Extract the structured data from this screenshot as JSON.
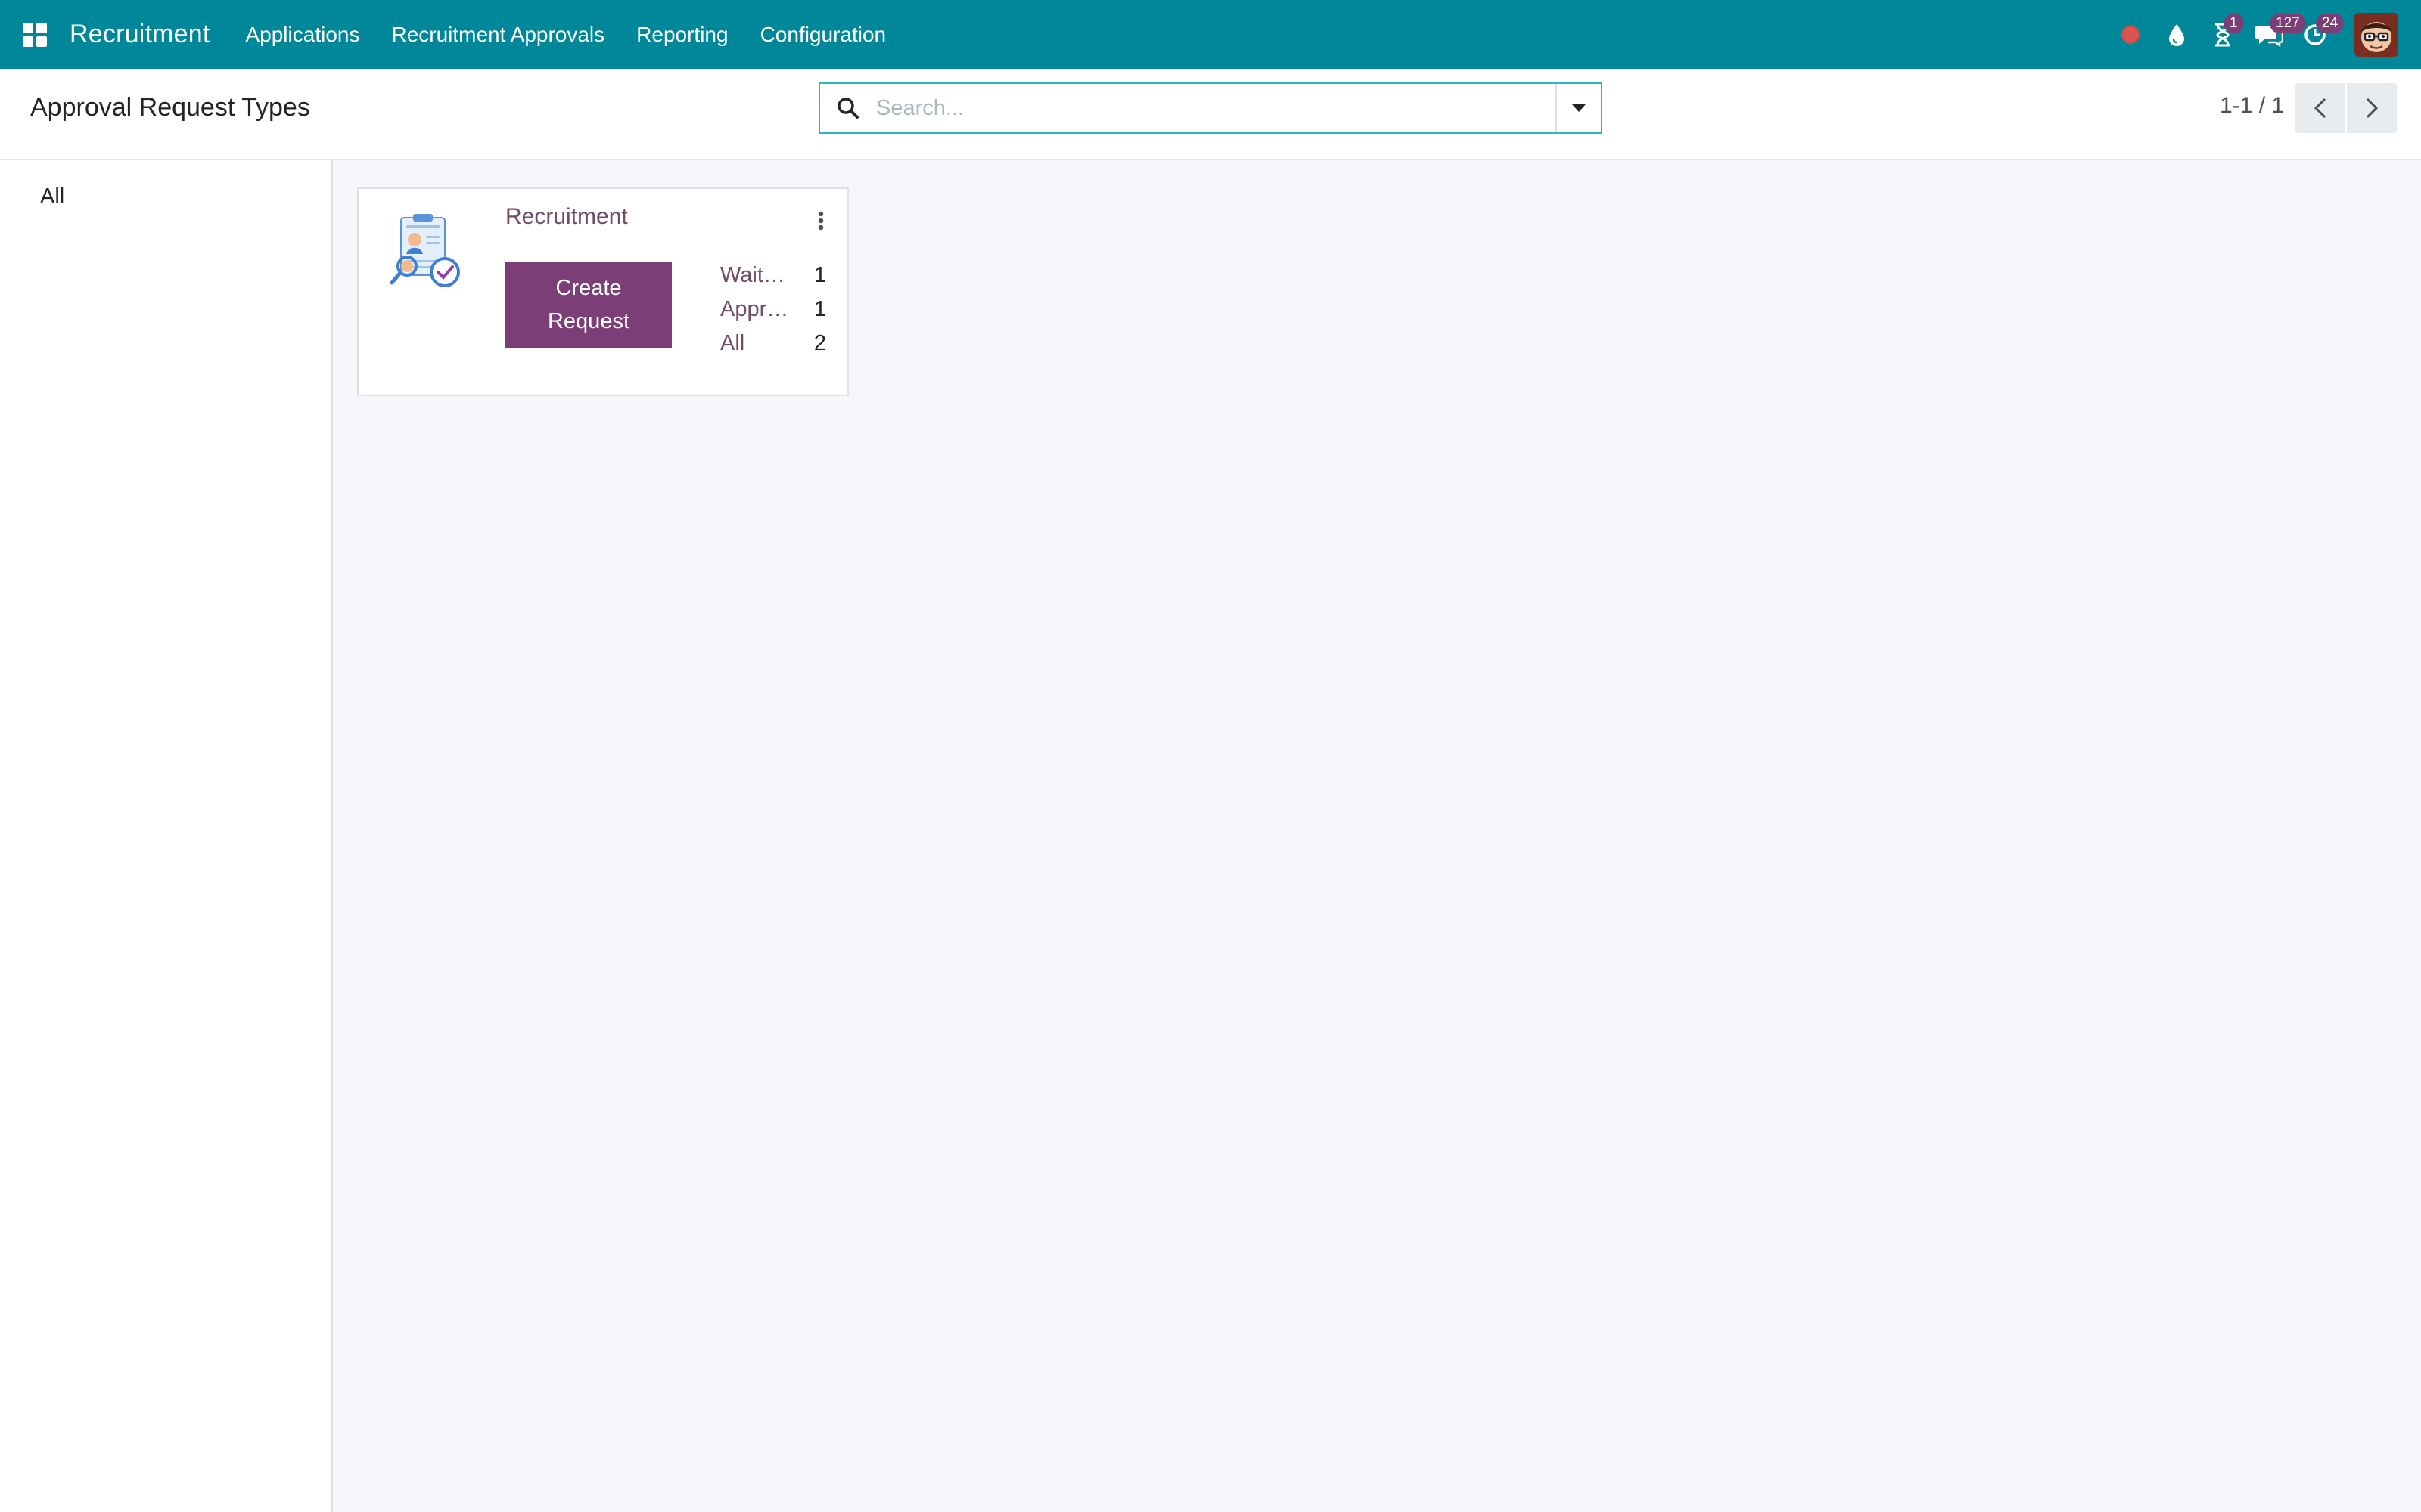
{
  "navbar": {
    "brand": "Recruitment",
    "menu": [
      {
        "label": "Applications"
      },
      {
        "label": "Recruitment Approvals"
      },
      {
        "label": "Reporting"
      },
      {
        "label": "Configuration"
      }
    ],
    "systray": {
      "activity_badge": "1",
      "messages_badge": "127",
      "clock_badge": "24"
    },
    "bg_color": "#00889a"
  },
  "control_panel": {
    "title": "Approval Request Types",
    "search": {
      "placeholder": "Search...",
      "value": ""
    },
    "pager": {
      "value": "1-1 / 1"
    }
  },
  "sidebar": {
    "items": [
      {
        "label": "All"
      }
    ]
  },
  "cards": [
    {
      "title": "Recruitment",
      "image_icon": "approval-document-icon",
      "create_button_label": "Create\nRequest",
      "stats": [
        {
          "label": "Wait…",
          "count": "1"
        },
        {
          "label": "Appr…",
          "count": "1"
        },
        {
          "label": "All",
          "count": "2"
        }
      ]
    }
  ],
  "colors": {
    "accent": "#7c3e77",
    "link": "#714b67",
    "search_border": "#2bb7c4"
  }
}
